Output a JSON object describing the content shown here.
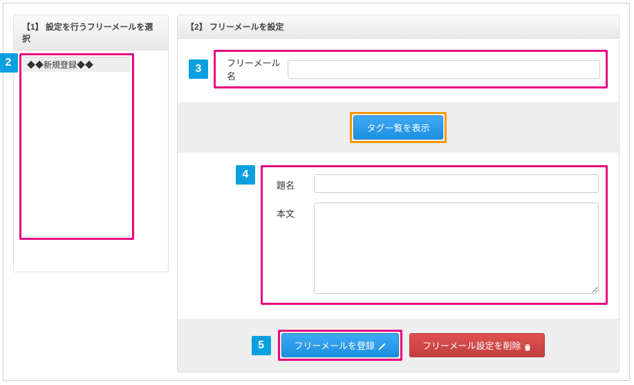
{
  "steps": {
    "s2": "2",
    "s3": "3",
    "s4": "4",
    "s5": "5"
  },
  "left": {
    "header": "【1】 設定を行うフリーメールを選択",
    "items": [
      "◆◆新規登録◆◆"
    ]
  },
  "right": {
    "header": "【2】 フリーメールを設定",
    "name_label": "フリーメール名",
    "name_value": "",
    "tag_button": "タグ一覧を表示",
    "subject_label": "題名",
    "subject_value": "",
    "body_label": "本文",
    "body_value": "",
    "register_button": "フリーメールを登録",
    "delete_button": "フリーメール設定を削除"
  }
}
